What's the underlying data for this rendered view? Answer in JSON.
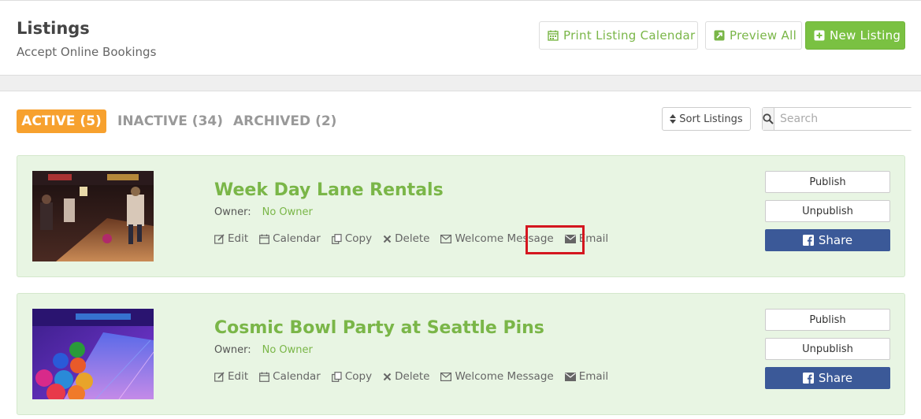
{
  "header": {
    "title": "Listings",
    "subtitle": "Accept Online Bookings",
    "print_label": "Print Listing Calendar",
    "preview_label": "Preview All",
    "new_label": "New Listing"
  },
  "tabs": {
    "active": "ACTIVE (5)",
    "inactive": "INACTIVE (34)",
    "archived": "ARCHIVED (2)"
  },
  "toolbar": {
    "sort_label": "Sort Listings",
    "search_placeholder": "Search"
  },
  "listings": [
    {
      "title": "Week Day Lane Rentals",
      "owner_label": "Owner:",
      "owner_value": "No Owner",
      "actions": {
        "edit": "Edit",
        "calendar": "Calendar",
        "copy": "Copy",
        "delete": "Delete",
        "welcome": "Welcome Message",
        "email": "Email"
      },
      "publish": "Publish",
      "unpublish": "Unpublish",
      "share": "Share"
    },
    {
      "title": "Cosmic Bowl Party at Seattle Pins",
      "owner_label": "Owner:",
      "owner_value": "No Owner",
      "actions": {
        "edit": "Edit",
        "calendar": "Calendar",
        "copy": "Copy",
        "delete": "Delete",
        "welcome": "Welcome Message",
        "email": "Email"
      },
      "publish": "Publish",
      "unpublish": "Unpublish",
      "share": "Share"
    }
  ],
  "colors": {
    "accent_green": "#7ab648",
    "tab_orange": "#f7a12e",
    "facebook_blue": "#3b5998",
    "highlight_red": "#d4161f"
  }
}
